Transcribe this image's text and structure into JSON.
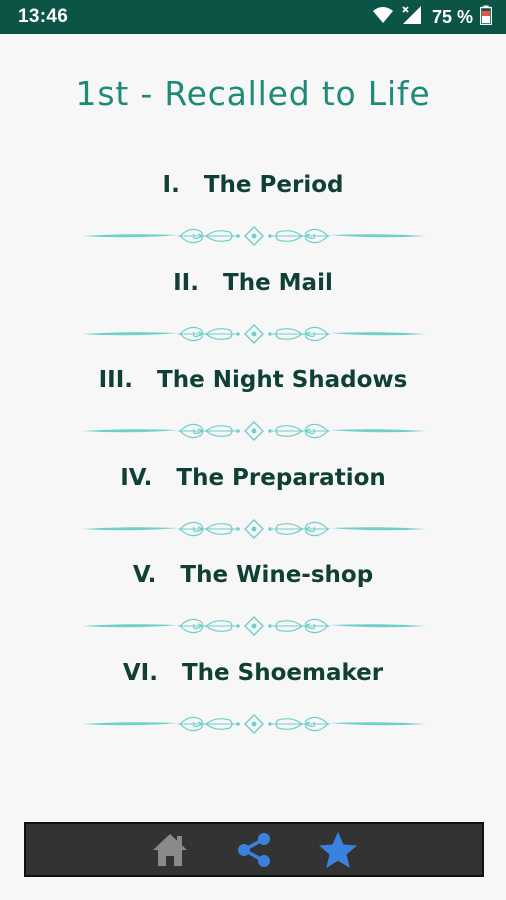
{
  "status_bar": {
    "time": "13:46",
    "battery": "75 %",
    "icons": [
      "wifi-icon",
      "signal-icon",
      "battery-icon"
    ],
    "background_color": "#0c5446"
  },
  "page": {
    "title": "1st - Recalled to Life",
    "title_color": "#1e8a78"
  },
  "chapters": [
    {
      "label": "I.   The Period"
    },
    {
      "label": "II.   The Mail"
    },
    {
      "label": "III.   The Night Shadows"
    },
    {
      "label": "IV.   The Preparation"
    },
    {
      "label": "V.   The Wine-shop"
    },
    {
      "label": "VI.   The Shoemaker"
    }
  ],
  "divider_color": "#6fcfcb",
  "bottom_nav": {
    "items": [
      {
        "icon": "home-icon",
        "color": "#8a8a8a"
      },
      {
        "icon": "share-icon",
        "color": "#3b82e0"
      },
      {
        "icon": "star-icon",
        "color": "#3b82e0"
      }
    ],
    "background_color": "#333333"
  }
}
